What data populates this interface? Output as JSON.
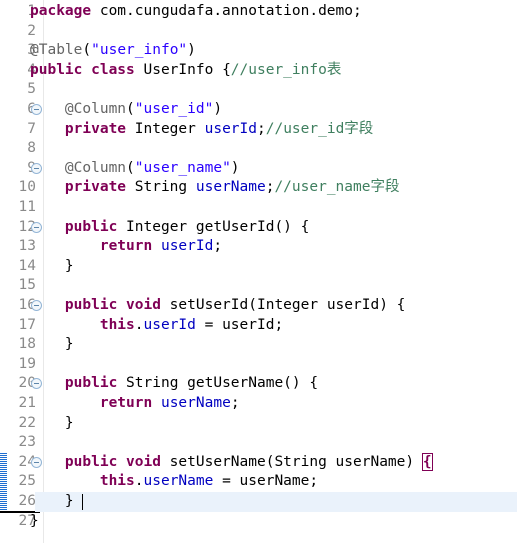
{
  "editor": {
    "app": "java-source-editor",
    "language": "Java",
    "font_size_px": 14.5,
    "line_height_px": 19.6,
    "total_lines": 27,
    "current_line": 26,
    "colors": {
      "background": "#ffffff",
      "keyword": "#7f0055",
      "string": "#2a00ff",
      "comment": "#3f7f5f",
      "annotation": "#646464",
      "field": "#0000c0",
      "plain": "#000000",
      "line_number": "#8a8a8a",
      "current_line_highlight": "#eaf2fb",
      "change_bar": "#1f6fd0",
      "bracket_match_outline": "#7f0055",
      "gutter_separator": "#e8e8e8"
    },
    "gutter": {
      "line_numbers": [
        "1",
        "2",
        "3",
        "4",
        "5",
        "6",
        "7",
        "8",
        "9",
        "10",
        "11",
        "12",
        "13",
        "14",
        "15",
        "16",
        "17",
        "18",
        "19",
        "20",
        "21",
        "22",
        "23",
        "24",
        "25",
        "26",
        "27"
      ],
      "fold_marker_icon": "collapse-minus-circle-icon",
      "fold_marker_lines": [
        6,
        9,
        12,
        16,
        20,
        24
      ],
      "change_bar_lines": [
        24,
        25,
        26
      ],
      "change_bar_underline_after_line": 26
    },
    "lines": [
      {
        "n": 1,
        "indent": 0,
        "tokens": [
          {
            "t": "package",
            "c": "kw"
          },
          {
            "t": " com.cungudafa.annotation.demo;",
            "c": "pln"
          }
        ]
      },
      {
        "n": 2,
        "indent": 0,
        "tokens": []
      },
      {
        "n": 3,
        "indent": 0,
        "tokens": [
          {
            "t": "@Table",
            "c": "ann"
          },
          {
            "t": "(",
            "c": "pln"
          },
          {
            "t": "\"user_info\"",
            "c": "str"
          },
          {
            "t": ")",
            "c": "pln"
          }
        ]
      },
      {
        "n": 4,
        "indent": 0,
        "tokens": [
          {
            "t": "public class",
            "c": "kw"
          },
          {
            "t": " UserInfo {",
            "c": "pln"
          },
          {
            "t": "//user_info表",
            "c": "cmt"
          }
        ]
      },
      {
        "n": 5,
        "indent": 0,
        "tokens": []
      },
      {
        "n": 6,
        "indent": 1,
        "tokens": [
          {
            "t": "@Column",
            "c": "ann"
          },
          {
            "t": "(",
            "c": "pln"
          },
          {
            "t": "\"user_id\"",
            "c": "str"
          },
          {
            "t": ")",
            "c": "pln"
          }
        ]
      },
      {
        "n": 7,
        "indent": 1,
        "tokens": [
          {
            "t": "private",
            "c": "kw"
          },
          {
            "t": " Integer ",
            "c": "pln"
          },
          {
            "t": "userId",
            "c": "fld"
          },
          {
            "t": ";",
            "c": "pln"
          },
          {
            "t": "//user_id字段",
            "c": "cmt"
          }
        ]
      },
      {
        "n": 8,
        "indent": 0,
        "tokens": []
      },
      {
        "n": 9,
        "indent": 1,
        "tokens": [
          {
            "t": "@Column",
            "c": "ann"
          },
          {
            "t": "(",
            "c": "pln"
          },
          {
            "t": "\"user_name\"",
            "c": "str"
          },
          {
            "t": ")",
            "c": "pln"
          }
        ]
      },
      {
        "n": 10,
        "indent": 1,
        "tokens": [
          {
            "t": "private",
            "c": "kw"
          },
          {
            "t": " String ",
            "c": "pln"
          },
          {
            "t": "userName",
            "c": "fld"
          },
          {
            "t": ";",
            "c": "pln"
          },
          {
            "t": "//user_name字段",
            "c": "cmt"
          }
        ]
      },
      {
        "n": 11,
        "indent": 0,
        "tokens": []
      },
      {
        "n": 12,
        "indent": 1,
        "tokens": [
          {
            "t": "public",
            "c": "kw"
          },
          {
            "t": " Integer getUserId() {",
            "c": "pln"
          }
        ]
      },
      {
        "n": 13,
        "indent": 2,
        "tokens": [
          {
            "t": "return",
            "c": "kw"
          },
          {
            "t": " ",
            "c": "pln"
          },
          {
            "t": "userId",
            "c": "fld"
          },
          {
            "t": ";",
            "c": "pln"
          }
        ]
      },
      {
        "n": 14,
        "indent": 1,
        "tokens": [
          {
            "t": "}",
            "c": "pln"
          }
        ]
      },
      {
        "n": 15,
        "indent": 0,
        "tokens": []
      },
      {
        "n": 16,
        "indent": 1,
        "tokens": [
          {
            "t": "public void",
            "c": "kw"
          },
          {
            "t": " setUserId(Integer userId) {",
            "c": "pln"
          }
        ]
      },
      {
        "n": 17,
        "indent": 2,
        "tokens": [
          {
            "t": "this",
            "c": "kw"
          },
          {
            "t": ".",
            "c": "pln"
          },
          {
            "t": "userId",
            "c": "fld"
          },
          {
            "t": " = userId;",
            "c": "pln"
          }
        ]
      },
      {
        "n": 18,
        "indent": 1,
        "tokens": [
          {
            "t": "}",
            "c": "pln"
          }
        ]
      },
      {
        "n": 19,
        "indent": 0,
        "tokens": []
      },
      {
        "n": 20,
        "indent": 1,
        "tokens": [
          {
            "t": "public",
            "c": "kw"
          },
          {
            "t": " String getUserName() {",
            "c": "pln"
          }
        ]
      },
      {
        "n": 21,
        "indent": 2,
        "tokens": [
          {
            "t": "return",
            "c": "kw"
          },
          {
            "t": " ",
            "c": "pln"
          },
          {
            "t": "userName",
            "c": "fld"
          },
          {
            "t": ";",
            "c": "pln"
          }
        ]
      },
      {
        "n": 22,
        "indent": 1,
        "tokens": [
          {
            "t": "}",
            "c": "pln"
          }
        ]
      },
      {
        "n": 23,
        "indent": 0,
        "tokens": []
      },
      {
        "n": 24,
        "indent": 1,
        "tokens": [
          {
            "t": "public void",
            "c": "kw"
          },
          {
            "t": " setUserName(String userName) ",
            "c": "pln"
          },
          {
            "t": "{",
            "c": "bracket-box"
          }
        ]
      },
      {
        "n": 25,
        "indent": 2,
        "tokens": [
          {
            "t": "this",
            "c": "kw"
          },
          {
            "t": ".",
            "c": "pln"
          },
          {
            "t": "userName",
            "c": "fld"
          },
          {
            "t": " = userName;",
            "c": "pln"
          }
        ]
      },
      {
        "n": 26,
        "indent": 1,
        "tokens": [
          {
            "t": "}",
            "c": "pln"
          }
        ]
      },
      {
        "n": 27,
        "indent": 0,
        "tokens": [
          {
            "t": "}",
            "c": "pln"
          }
        ]
      }
    ],
    "caret": {
      "line": 26,
      "column": 6
    }
  }
}
